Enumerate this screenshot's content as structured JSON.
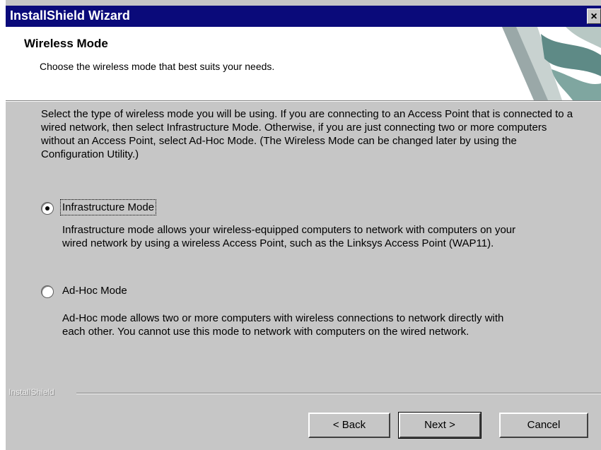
{
  "window": {
    "title": "InstallShield Wizard",
    "close_glyph": "×"
  },
  "header": {
    "title": "Wireless Mode",
    "subtitle": "Choose the wireless mode that best suits your needs."
  },
  "intro_text": "Select the type of wireless mode you will be using. If you are connecting to an Access Point that is connected to a wired network, then select Infrastructure Mode. Otherwise, if you are just connecting two or more computers without an Access Point, select Ad-Hoc Mode. (The Wireless Mode can be changed later by using the Configuration Utility.)",
  "options": [
    {
      "label": "Infrastructure Mode",
      "selected": true,
      "description": "Infrastructure mode allows your wireless-equipped computers to network with computers on your wired network by using a wireless Access Point, such as the Linksys Access Point (WAP11)."
    },
    {
      "label": "Ad-Hoc Mode",
      "selected": false,
      "description": "Ad-Hoc mode allows two or more computers with wireless connections to network directly with each other. You cannot use this mode to network with computers on the wired network."
    }
  ],
  "footer": {
    "brand": "InstallShield",
    "back_label": "< Back",
    "next_label": "Next >",
    "cancel_label": "Cancel"
  }
}
